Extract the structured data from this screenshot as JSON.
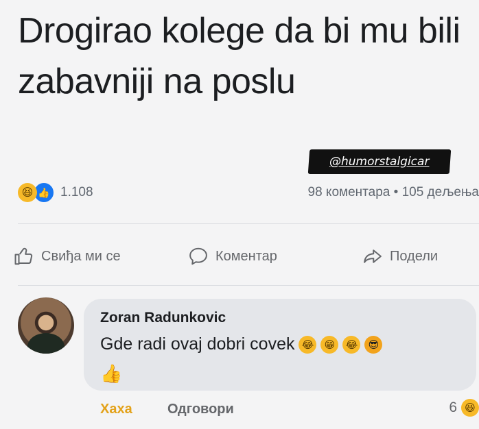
{
  "post": {
    "text": "Drogirao kolege da bi mu bili zabavniji na poslu",
    "watermark": "@humorstalgicar"
  },
  "engagement": {
    "reaction_icons": [
      "haha-icon",
      "like-icon"
    ],
    "reaction_count": "1.108",
    "comments_label": "98 коментара",
    "separator": "•",
    "shares_label": "105 дељења"
  },
  "actions": {
    "like": "Свиђа ми се",
    "comment": "Коментар",
    "share": "Подели"
  },
  "comment": {
    "author": "Zoran Radunkovic",
    "text": "Gde radi ovaj dobri covek",
    "emojis": [
      "😂",
      "😁",
      "😂",
      "😎"
    ],
    "trailing_emoji": "👍",
    "haha_label": "Хаха",
    "reply_label": "Одговори",
    "reaction_count": "6"
  },
  "colors": {
    "background": "#f4f4f5",
    "bubble": "#e4e6ea",
    "haha_accent": "#e3a21a",
    "like_blue": "#1877f2"
  }
}
